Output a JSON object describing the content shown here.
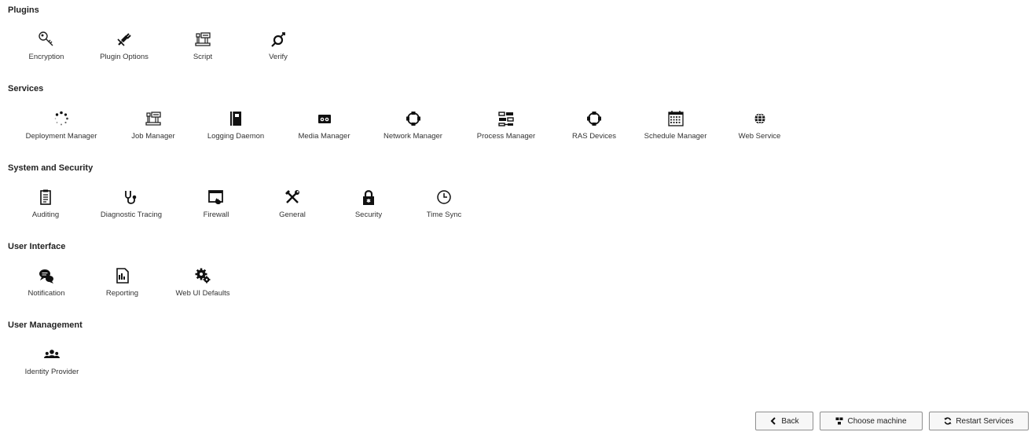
{
  "sections": [
    {
      "title": "Plugins",
      "items": [
        {
          "label": "Encryption",
          "icon": "key-icon"
        },
        {
          "label": "Plugin Options",
          "icon": "plug-icon"
        },
        {
          "label": "Script",
          "icon": "script-icon"
        },
        {
          "label": "Verify",
          "icon": "verify-icon"
        }
      ]
    },
    {
      "title": "Services",
      "items": [
        {
          "label": "Deployment Manager",
          "icon": "spinner-icon"
        },
        {
          "label": "Job Manager",
          "icon": "job-icon"
        },
        {
          "label": "Logging Daemon",
          "icon": "book-icon"
        },
        {
          "label": "Media Manager",
          "icon": "tape-icon"
        },
        {
          "label": "Network Manager",
          "icon": "network-icon"
        },
        {
          "label": "Process Manager",
          "icon": "process-icon"
        },
        {
          "label": "RAS Devices",
          "icon": "network-icon"
        },
        {
          "label": "Schedule Manager",
          "icon": "calendar-icon"
        },
        {
          "label": "Web Service",
          "icon": "globe-icon"
        }
      ]
    },
    {
      "title": "System and Security",
      "items": [
        {
          "label": "Auditing",
          "icon": "clipboard-icon"
        },
        {
          "label": "Diagnostic Tracing",
          "icon": "stethoscope-icon"
        },
        {
          "label": "Firewall",
          "icon": "firewall-icon"
        },
        {
          "label": "General",
          "icon": "tools-icon"
        },
        {
          "label": "Security",
          "icon": "lock-icon"
        },
        {
          "label": "Time Sync",
          "icon": "clock-icon"
        }
      ]
    },
    {
      "title": "User Interface",
      "items": [
        {
          "label": "Notification",
          "icon": "chat-icon"
        },
        {
          "label": "Reporting",
          "icon": "report-icon"
        },
        {
          "label": "Web UI Defaults",
          "icon": "gears-icon"
        }
      ]
    },
    {
      "title": "User Management",
      "items": [
        {
          "label": "Identity Provider",
          "icon": "users-icon"
        }
      ]
    }
  ],
  "buttons": {
    "back": "Back",
    "choose_machine": "Choose machine",
    "restart_services": "Restart Services"
  }
}
